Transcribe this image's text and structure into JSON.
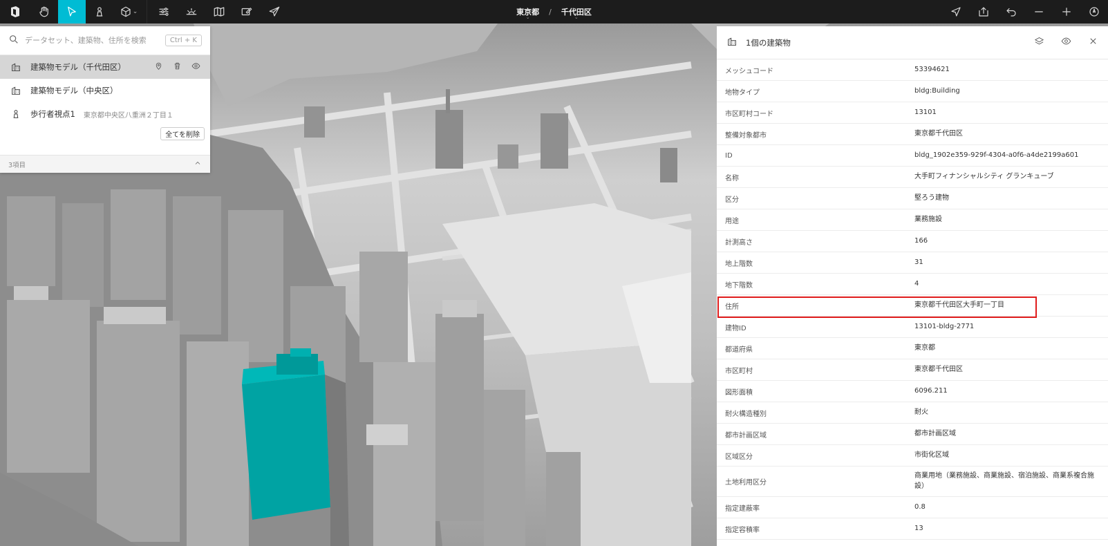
{
  "toolbar": {
    "left_icons": [
      "logo-icon",
      "hand-icon",
      "select-arrow-icon",
      "pedestrian-icon",
      "cube-icon",
      "sliders-icon",
      "sun-icon",
      "map-icon",
      "sketch-icon",
      "paper-plane-icon"
    ],
    "right_icons": [
      "navigate-icon",
      "share-icon",
      "undo-icon",
      "zoom-out-icon",
      "zoom-in-icon",
      "compass-icon"
    ],
    "accent_color": "#00bcd4"
  },
  "breadcrumb": {
    "prefecture": "東京都",
    "separator": "/",
    "ward": "千代田区"
  },
  "search": {
    "placeholder": "データセット、建築物、住所を検索",
    "shortcut": "Ctrl + K"
  },
  "layers": [
    {
      "label": "建築物モデル（千代田区）",
      "icon": "building-icon",
      "selected": true
    },
    {
      "label": "建築物モデル（中央区）",
      "icon": "building-icon",
      "selected": false
    },
    {
      "label": "歩行者視点1",
      "sub": "東京都中央区八重洲２丁目１",
      "icon": "pedestrian-icon",
      "selected": false
    }
  ],
  "delete_all_label": "全てを削除",
  "layer_count": "3項目",
  "inspector": {
    "title": "1個の建築物",
    "attributes": [
      {
        "key": "メッシュコード",
        "value": "53394621"
      },
      {
        "key": "地物タイプ",
        "value": "bldg:Building"
      },
      {
        "key": "市区町村コード",
        "value": "13101"
      },
      {
        "key": "整備対象都市",
        "value": "東京都千代田区"
      },
      {
        "key": "ID",
        "value": "bldg_1902e359-929f-4304-a0f6-a4de2199a601"
      },
      {
        "key": "名称",
        "value": "大手町フィナンシャルシティ グランキューブ"
      },
      {
        "key": "区分",
        "value": "堅ろう建物"
      },
      {
        "key": "用途",
        "value": "業務施設"
      },
      {
        "key": "計測高さ",
        "value": "166"
      },
      {
        "key": "地上階数",
        "value": "31"
      },
      {
        "key": "地下階数",
        "value": "4"
      },
      {
        "key": "住所",
        "value": "東京都千代田区大手町一丁目",
        "highlight": true
      },
      {
        "key": "建物ID",
        "value": "13101-bldg-2771"
      },
      {
        "key": "都道府県",
        "value": "東京都"
      },
      {
        "key": "市区町村",
        "value": "東京都千代田区"
      },
      {
        "key": "図形面積",
        "value": "6096.211"
      },
      {
        "key": "耐火構造種別",
        "value": "耐火"
      },
      {
        "key": "都市計画区域",
        "value": "都市計画区域"
      },
      {
        "key": "区域区分",
        "value": "市街化区域"
      },
      {
        "key": "土地利用区分",
        "value": "商業用地（業務施設、商業施設、宿泊施設、商業系複合施設）"
      },
      {
        "key": "指定建蔽率",
        "value": "0.8"
      },
      {
        "key": "指定容積率",
        "value": "13"
      }
    ]
  },
  "map": {
    "selected_building_color": "#00a3a3"
  }
}
